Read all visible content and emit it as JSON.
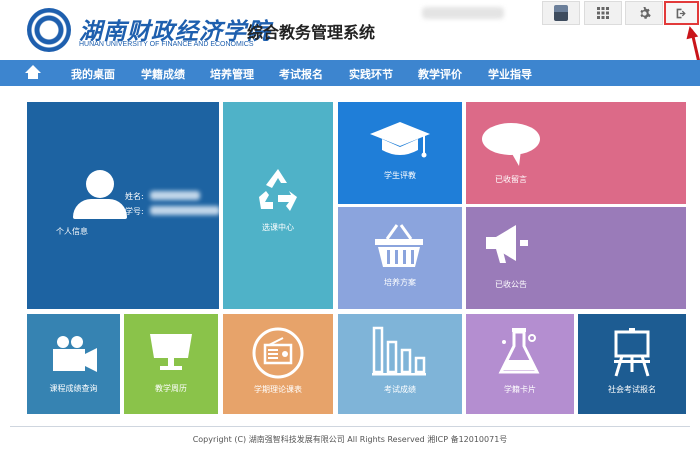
{
  "header": {
    "school_name": "湖南财政经济学院",
    "school_name_en": "HUNAN UNIVERSITY OF FINANCE AND ECONOMICS",
    "system_name": "综合教务管理系统",
    "icons": [
      "avatar",
      "apps-grid-icon",
      "gear-icon",
      "logout-icon"
    ]
  },
  "nav": {
    "home_icon": "home-icon",
    "items": [
      "我的桌面",
      "学籍成绩",
      "培养管理",
      "考试报名",
      "实践环节",
      "教学评价",
      "学业指导"
    ]
  },
  "profile": {
    "label": "个人信息",
    "name_label": "姓名:",
    "id_label": "学号:"
  },
  "tiles": {
    "course_select": "选课中心",
    "student_eval": "学生评教",
    "received_msg": "已收留言",
    "training_plan": "培养方案",
    "received_notice": "已收公告",
    "grade_query": "课程成绩查询",
    "teaching_calendar": "教学周历",
    "theory_schedule": "学期理论课表",
    "exam_results": "考试成绩",
    "student_card": "学籍卡片",
    "social_exam": "社会考试报名"
  },
  "colors": {
    "nav": "#3d85cf",
    "dark_blue": "#1d63a2",
    "teal": "#4fb2c8",
    "blue": "#1f7ed8",
    "pink": "#dc6a88",
    "lavender": "#8ba4dd",
    "purple": "#9a7bb9",
    "steel_blue": "#3683b2",
    "green": "#8ac34a",
    "orange": "#e7a36a",
    "light_blue": "#7fb4d8",
    "light_purple": "#b48ed0",
    "navy": "#1d5c92",
    "alert_red": "#c9151a"
  },
  "footer": {
    "copyright": "Copyright (C) 湖南强智科技发展有限公司 All Rights Reserved 湘ICP 备12010071号"
  }
}
